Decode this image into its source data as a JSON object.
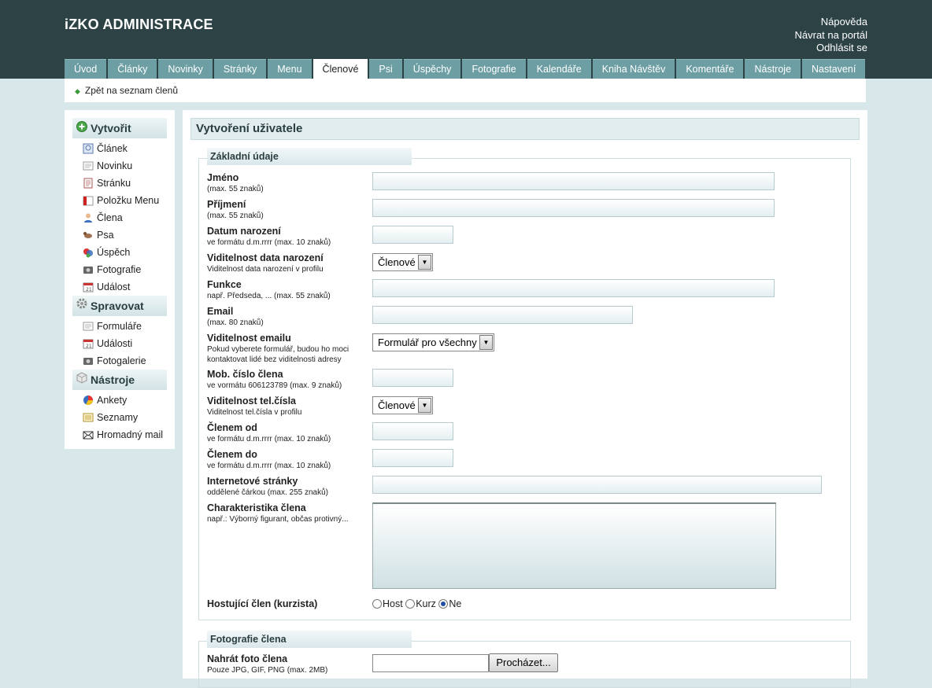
{
  "app": {
    "title": "iZKO ADMINISTRACE"
  },
  "top_links": [
    "Nápověda",
    "Návrat na portál",
    "Odhlásit se"
  ],
  "tabs": [
    "Úvod",
    "Články",
    "Novinky",
    "Stránky",
    "Menu",
    "Členové",
    "Psi",
    "Úspěchy",
    "Fotografie",
    "Kalendáře",
    "Kniha Návštěv",
    "Komentáře",
    "Nástroje",
    "Nastavení"
  ],
  "active_tab": "Členové",
  "breadcrumb": {
    "back_label": "Zpět na seznam členů"
  },
  "sidebar": {
    "create": {
      "title": "Vytvořit",
      "items": [
        {
          "label": "Článek",
          "icon": "article-icon"
        },
        {
          "label": "Novinku",
          "icon": "news-icon"
        },
        {
          "label": "Stránku",
          "icon": "page-icon"
        },
        {
          "label": "Položku Menu",
          "icon": "menu-item-icon"
        },
        {
          "label": "Člena",
          "icon": "member-icon"
        },
        {
          "label": "Psa",
          "icon": "dog-icon"
        },
        {
          "label": "Úspěch",
          "icon": "success-icon"
        },
        {
          "label": "Fotografie",
          "icon": "camera-icon"
        },
        {
          "label": "Událost",
          "icon": "calendar-icon"
        }
      ]
    },
    "manage": {
      "title": "Spravovat",
      "items": [
        {
          "label": "Formuláře",
          "icon": "form-icon"
        },
        {
          "label": "Události",
          "icon": "calendar-icon"
        },
        {
          "label": "Fotogalerie",
          "icon": "camera-icon"
        }
      ]
    },
    "tools": {
      "title": "Nástroje",
      "items": [
        {
          "label": "Ankety",
          "icon": "pie-chart-icon"
        },
        {
          "label": "Seznamy",
          "icon": "list-icon"
        },
        {
          "label": "Hromadný mail",
          "icon": "mail-icon"
        }
      ]
    }
  },
  "form": {
    "title": "Vytvoření uživatele",
    "basic_legend": "Základní údaje",
    "fields": {
      "name": {
        "label": "Jméno",
        "hint": "(max. 55 znaků)"
      },
      "surname": {
        "label": "Příjmení",
        "hint": "(max. 55 znaků)"
      },
      "birthdate": {
        "label": "Datum narození",
        "hint": "ve formátu d.m.rrrr (max. 10 znaků)"
      },
      "birthdate_visibility": {
        "label": "Viditelnost data narození",
        "hint": "Viditelnost data narození v profilu",
        "value": "Členové"
      },
      "function": {
        "label": "Funkce",
        "hint": "např. Předseda, ... (max. 55 znaků)"
      },
      "email": {
        "label": "Email",
        "hint": "(max. 80 znaků)"
      },
      "email_visibility": {
        "label": "Viditelnost emailu",
        "hint1": "Pokud vyberete formulář, budou ho moci",
        "hint2": "kontaktovat lidé bez viditelnosti adresy",
        "value": "Formulář pro všechny"
      },
      "phone": {
        "label": "Mob. číslo člena",
        "hint": "ve vormátu 606123789 (max. 9 znaků)"
      },
      "phone_visibility": {
        "label": "Viditelnost tel.čísla",
        "hint": "Viditelnost tel.čísla v profilu",
        "value": "Členové"
      },
      "member_from": {
        "label": "Členem od",
        "hint": "ve formátu d.m.rrrr (max. 10 znaků)"
      },
      "member_to": {
        "label": "Členem do",
        "hint": "ve formátu d.m.rrrr (max. 10 znaků)"
      },
      "website": {
        "label": "Internetové stránky",
        "hint": "oddělené čárkou (max. 255 znaků)"
      },
      "characteristic": {
        "label": "Charakteristika člena",
        "hint": "např.: Výborný figurant, občas protivný..."
      },
      "hosting": {
        "label": "Hostující člen (kurzista)",
        "options": [
          "Host",
          "Kurz",
          "Ne"
        ],
        "selected": "Ne"
      }
    },
    "photo_legend": "Fotografie člena",
    "photo": {
      "label": "Nahrát foto člena",
      "hint": "Pouze JPG, GIF, PNG (max. 2MB)",
      "browse_label": "Procházet..."
    }
  }
}
